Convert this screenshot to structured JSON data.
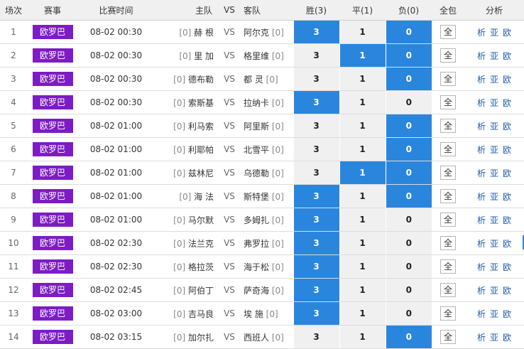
{
  "headers": {
    "no": "场次",
    "league": "赛事",
    "time": "比赛时间",
    "home": "主队",
    "vs": "VS",
    "away": "客队",
    "win": "胜(3)",
    "draw": "平(1)",
    "lose": "负(0)",
    "all": "全包",
    "analysis": "分析"
  },
  "colors": {
    "league_tag": "#7d1cc4",
    "selected_odd": "#2a86dd",
    "unselected_odd": "#f0f0f0"
  },
  "rows": [
    {
      "no": "1",
      "league": "欧罗巴",
      "time": "08-02 00:30",
      "home_rank": "[0]",
      "home": "赫 根",
      "vs": "VS",
      "away": "阿尔克",
      "away_rank": "[0]",
      "win": "3",
      "draw": "1",
      "lose": "0",
      "sel": [
        true,
        false,
        true
      ],
      "all": "全",
      "a1": "析",
      "a2": "亚",
      "a3": "欧"
    },
    {
      "no": "2",
      "league": "欧罗巴",
      "time": "08-02 00:30",
      "home_rank": "[0]",
      "home": "里 加",
      "vs": "VS",
      "away": "格里维",
      "away_rank": "[0]",
      "win": "3",
      "draw": "1",
      "lose": "0",
      "sel": [
        false,
        true,
        true
      ],
      "all": "全",
      "a1": "析",
      "a2": "亚",
      "a3": "欧"
    },
    {
      "no": "3",
      "league": "欧罗巴",
      "time": "08-02 00:30",
      "home_rank": "[0]",
      "home": "德布勒",
      "vs": "VS",
      "away": "都 灵",
      "away_rank": "[0]",
      "win": "3",
      "draw": "1",
      "lose": "0",
      "sel": [
        false,
        false,
        true
      ],
      "all": "全",
      "a1": "析",
      "a2": "亚",
      "a3": "欧"
    },
    {
      "no": "4",
      "league": "欧罗巴",
      "time": "08-02 00:30",
      "home_rank": "[0]",
      "home": "索斯基",
      "vs": "VS",
      "away": "拉纳卡",
      "away_rank": "[0]",
      "win": "3",
      "draw": "1",
      "lose": "0",
      "sel": [
        true,
        false,
        false
      ],
      "all": "全",
      "a1": "析",
      "a2": "亚",
      "a3": "欧"
    },
    {
      "no": "5",
      "league": "欧罗巴",
      "time": "08-02 01:00",
      "home_rank": "[0]",
      "home": "利马索",
      "vs": "VS",
      "away": "阿里斯",
      "away_rank": "[0]",
      "win": "3",
      "draw": "1",
      "lose": "0",
      "sel": [
        false,
        false,
        true
      ],
      "all": "全",
      "a1": "析",
      "a2": "亚",
      "a3": "欧"
    },
    {
      "no": "6",
      "league": "欧罗巴",
      "time": "08-02 01:00",
      "home_rank": "[0]",
      "home": "利耶帕",
      "vs": "VS",
      "away": "北雪平",
      "away_rank": "[0]",
      "win": "3",
      "draw": "1",
      "lose": "0",
      "sel": [
        false,
        false,
        true
      ],
      "all": "全",
      "a1": "析",
      "a2": "亚",
      "a3": "欧"
    },
    {
      "no": "7",
      "league": "欧罗巴",
      "time": "08-02 01:00",
      "home_rank": "[0]",
      "home": "兹林尼",
      "vs": "VS",
      "away": "乌德勒",
      "away_rank": "[0]",
      "win": "3",
      "draw": "1",
      "lose": "0",
      "sel": [
        false,
        true,
        true
      ],
      "all": "全",
      "a1": "析",
      "a2": "亚",
      "a3": "欧"
    },
    {
      "no": "8",
      "league": "欧罗巴",
      "time": "08-02 01:00",
      "home_rank": "[0]",
      "home": "海 法",
      "vs": "VS",
      "away": "斯特堡",
      "away_rank": "[0]",
      "win": "3",
      "draw": "1",
      "lose": "0",
      "sel": [
        true,
        false,
        true
      ],
      "all": "全",
      "a1": "析",
      "a2": "亚",
      "a3": "欧"
    },
    {
      "no": "9",
      "league": "欧罗巴",
      "time": "08-02 01:00",
      "home_rank": "[0]",
      "home": "马尔默",
      "vs": "VS",
      "away": "多姆扎",
      "away_rank": "[0]",
      "win": "3",
      "draw": "1",
      "lose": "0",
      "sel": [
        true,
        false,
        false
      ],
      "all": "全",
      "a1": "析",
      "a2": "亚",
      "a3": "欧"
    },
    {
      "no": "10",
      "league": "欧罗巴",
      "time": "08-02 02:30",
      "home_rank": "[0]",
      "home": "法兰克",
      "vs": "VS",
      "away": "弗罗拉",
      "away_rank": "[0]",
      "win": "3",
      "draw": "1",
      "lose": "0",
      "sel": [
        true,
        false,
        false
      ],
      "all": "全",
      "a1": "析",
      "a2": "亚",
      "a3": "欧"
    },
    {
      "no": "11",
      "league": "欧罗巴",
      "time": "08-02 02:30",
      "home_rank": "[0]",
      "home": "格拉茨",
      "vs": "VS",
      "away": "海于松",
      "away_rank": "[0]",
      "win": "3",
      "draw": "1",
      "lose": "0",
      "sel": [
        true,
        false,
        false
      ],
      "all": "全",
      "a1": "析",
      "a2": "亚",
      "a3": "欧"
    },
    {
      "no": "12",
      "league": "欧罗巴",
      "time": "08-02 02:45",
      "home_rank": "[0]",
      "home": "阿伯丁",
      "vs": "VS",
      "away": "萨奇海",
      "away_rank": "[0]",
      "win": "3",
      "draw": "1",
      "lose": "0",
      "sel": [
        true,
        false,
        false
      ],
      "all": "全",
      "a1": "析",
      "a2": "亚",
      "a3": "欧"
    },
    {
      "no": "13",
      "league": "欧罗巴",
      "time": "08-02 03:00",
      "home_rank": "[0]",
      "home": "吉马良",
      "vs": "VS",
      "away": "埃 施",
      "away_rank": "[0]",
      "win": "3",
      "draw": "1",
      "lose": "0",
      "sel": [
        true,
        false,
        false
      ],
      "all": "全",
      "a1": "析",
      "a2": "亚",
      "a3": "欧"
    },
    {
      "no": "14",
      "league": "欧罗巴",
      "time": "08-02 03:15",
      "home_rank": "[0]",
      "home": "加尔扎",
      "vs": "VS",
      "away": "西班人",
      "away_rank": "[0]",
      "win": "3",
      "draw": "1",
      "lose": "0",
      "sel": [
        false,
        false,
        true
      ],
      "all": "全",
      "a1": "析",
      "a2": "亚",
      "a3": "欧"
    }
  ]
}
